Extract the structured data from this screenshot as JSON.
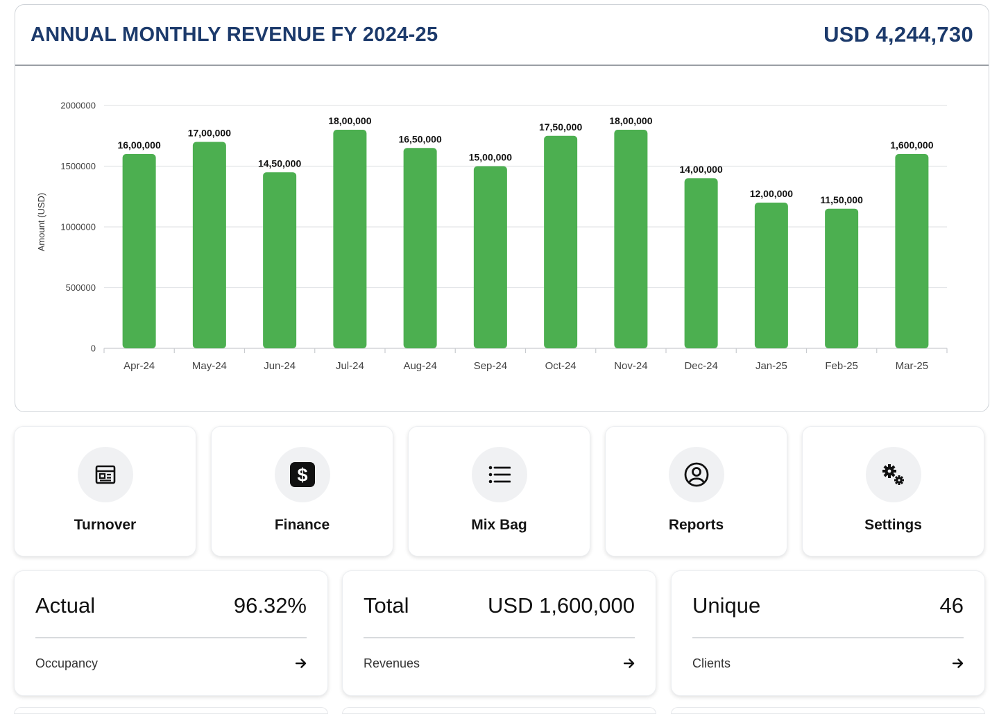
{
  "revenue": {
    "title": "ANNUAL MONTHLY REVENUE FY 2024-25",
    "total": "USD 4,244,730"
  },
  "chart_data": {
    "type": "bar",
    "categories": [
      "Apr-24",
      "May-24",
      "Jun-24",
      "Jul-24",
      "Aug-24",
      "Sep-24",
      "Oct-24",
      "Nov-24",
      "Dec-24",
      "Jan-25",
      "Feb-25",
      "Mar-25"
    ],
    "values": [
      1600000,
      1700000,
      1450000,
      1800000,
      1650000,
      1500000,
      1750000,
      1800000,
      1400000,
      1200000,
      1150000,
      1600000
    ],
    "data_labels": [
      "16,00,000",
      "17,00,000",
      "14,50,000",
      "18,00,000",
      "16,50,000",
      "15,00,000",
      "17,50,000",
      "18,00,000",
      "14,00,000",
      "12,00,000",
      "11,50,000",
      "1,600,000"
    ],
    "ylabel": "Amount (USD)",
    "ylim": [
      0,
      2000000
    ],
    "yticks": [
      0,
      500000,
      1000000,
      1500000,
      2000000
    ],
    "ytick_labels": [
      "0",
      "500000",
      "1000000",
      "1500000",
      "2000000"
    ],
    "grid": true,
    "bar_color": "#4caf50"
  },
  "tiles": [
    {
      "label": "Turnover",
      "icon": "newspaper-icon"
    },
    {
      "label": "Finance",
      "icon": "dollar-icon"
    },
    {
      "label": "Mix Bag",
      "icon": "list-icon"
    },
    {
      "label": "Reports",
      "icon": "user-circle-icon"
    },
    {
      "label": "Settings",
      "icon": "gears-icon"
    }
  ],
  "stats": [
    {
      "label": "Actual",
      "value": "96.32%",
      "sub": "Occupancy"
    },
    {
      "label": "Total",
      "value": "USD 1,600,000",
      "sub": "Revenues"
    },
    {
      "label": "Unique",
      "value": "46",
      "sub": "Clients"
    }
  ],
  "colors": {
    "title": "#1c3a6b",
    "bar": "#4caf50",
    "icon_bg": "#f0f1f3"
  }
}
